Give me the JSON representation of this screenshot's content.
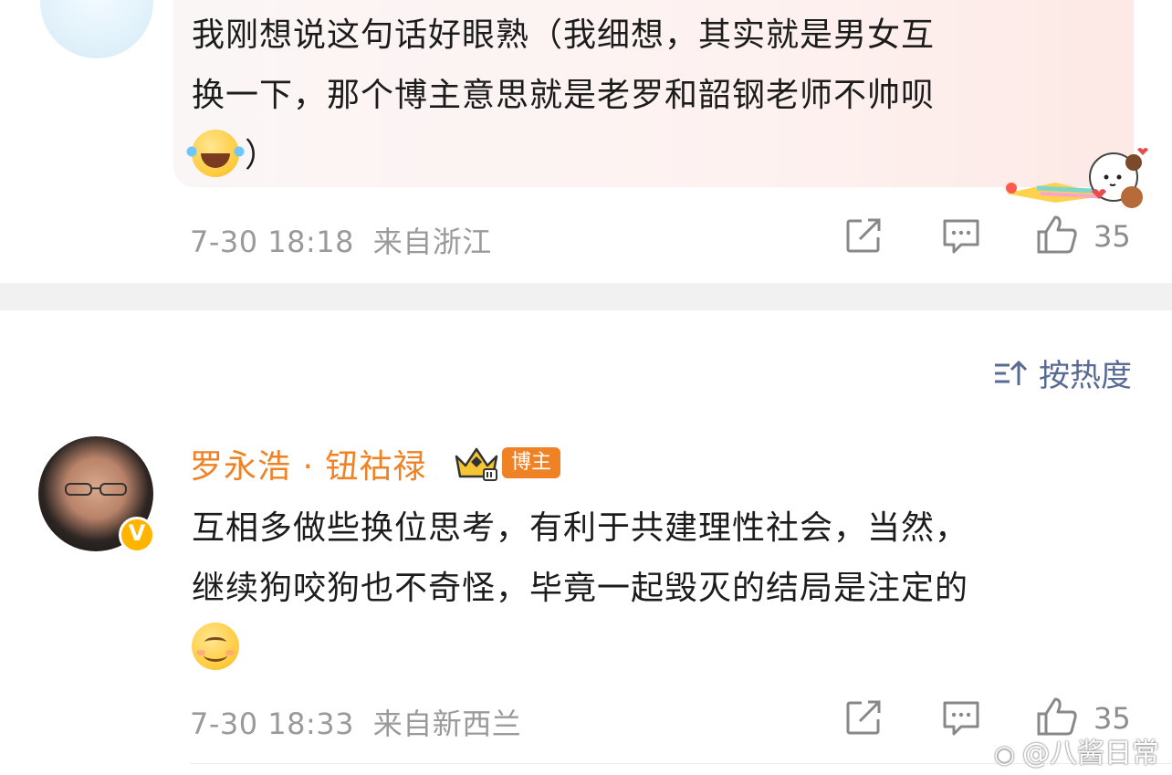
{
  "comment1": {
    "text_lines": [
      "我刚想说这句话好眼熟（我细想，其实就是男女互",
      "换一下，那个博主意思就是老罗和韶钢老师不帅呗"
    ],
    "text_tail": "）",
    "emoji": "laughing-tears-emoji",
    "time": "7-30 18:18",
    "location": "来自浙江",
    "likes": "35"
  },
  "sort": {
    "label": "按热度"
  },
  "comment2": {
    "username": "罗永浩 · 钮祜禄",
    "badge": "博主",
    "verified_mark": "V",
    "text_lines": [
      "互相多做些换位思考，有利于共建理性社会，当然，",
      "继续狗咬狗也不奇怪，毕竟一起毁灭的结局是注定的"
    ],
    "emoji": "smile-emoji",
    "time": "7-30 18:33",
    "location": "来自新西兰",
    "likes": "35"
  },
  "watermark": "@八酱日常",
  "colors": {
    "username": "#f08226",
    "meta": "#9a9a9a",
    "link": "#576b95",
    "divider": "#f1f1f1"
  }
}
